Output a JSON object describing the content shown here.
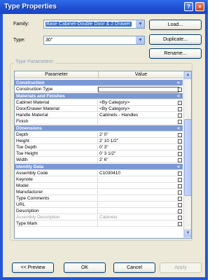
{
  "window": {
    "title": "Type Properties"
  },
  "family": {
    "label": "Family:",
    "value": "Base Cabinet-Double Door & 2 Drawer"
  },
  "type": {
    "label": "Type:",
    "value": "30\""
  },
  "buttons": {
    "load": "Load...",
    "duplicate": "Duplicate...",
    "rename": "Rename...",
    "preview": "<< Preview",
    "ok": "OK",
    "cancel": "Cancel",
    "apply": "Apply"
  },
  "params": {
    "group_title": "Type Parameters:",
    "col_parameter": "Parameter",
    "col_value": "Value",
    "rows": [
      {
        "kind": "cat",
        "name": "Construction"
      },
      {
        "kind": "param",
        "name": "Construction Type",
        "value": "",
        "edit": true
      },
      {
        "kind": "cat",
        "name": "Materials and Finishes"
      },
      {
        "kind": "param",
        "name": "Cabinet Material",
        "value": "<By Category>"
      },
      {
        "kind": "param",
        "name": "Door/Drawer Material",
        "value": "<By Category>"
      },
      {
        "kind": "param",
        "name": "Handle Material",
        "value": "Cabinets - Handles"
      },
      {
        "kind": "param",
        "name": "Finish",
        "value": ""
      },
      {
        "kind": "cat",
        "name": "Dimensions"
      },
      {
        "kind": "param",
        "name": "Depth",
        "value": "2'  0\""
      },
      {
        "kind": "param",
        "name": "Height",
        "value": "2'  10 1/2\""
      },
      {
        "kind": "param",
        "name": "Toe Depth",
        "value": "0'  3\""
      },
      {
        "kind": "param",
        "name": "Toe Height",
        "value": "0'  3 1/2\""
      },
      {
        "kind": "param",
        "name": "Width",
        "value": "2'  6\""
      },
      {
        "kind": "cat",
        "name": "Identity Data"
      },
      {
        "kind": "param",
        "name": "Assembly Code",
        "value": "C1030410"
      },
      {
        "kind": "param",
        "name": "Keynote",
        "value": ""
      },
      {
        "kind": "param",
        "name": "Model",
        "value": ""
      },
      {
        "kind": "param",
        "name": "Manufacturer",
        "value": ""
      },
      {
        "kind": "param",
        "name": "Type Comments",
        "value": ""
      },
      {
        "kind": "param",
        "name": "URL",
        "value": ""
      },
      {
        "kind": "param",
        "name": "Description",
        "value": ""
      },
      {
        "kind": "param",
        "name": "Assembly Description",
        "value": "Cabinets",
        "dim": true
      },
      {
        "kind": "param",
        "name": "Type Mark",
        "value": ""
      }
    ]
  },
  "icons": {
    "help": "?",
    "close": "×",
    "dropdown": "▼",
    "collapse": "«",
    "scroll_up": "▲",
    "scroll_down": "▼"
  }
}
